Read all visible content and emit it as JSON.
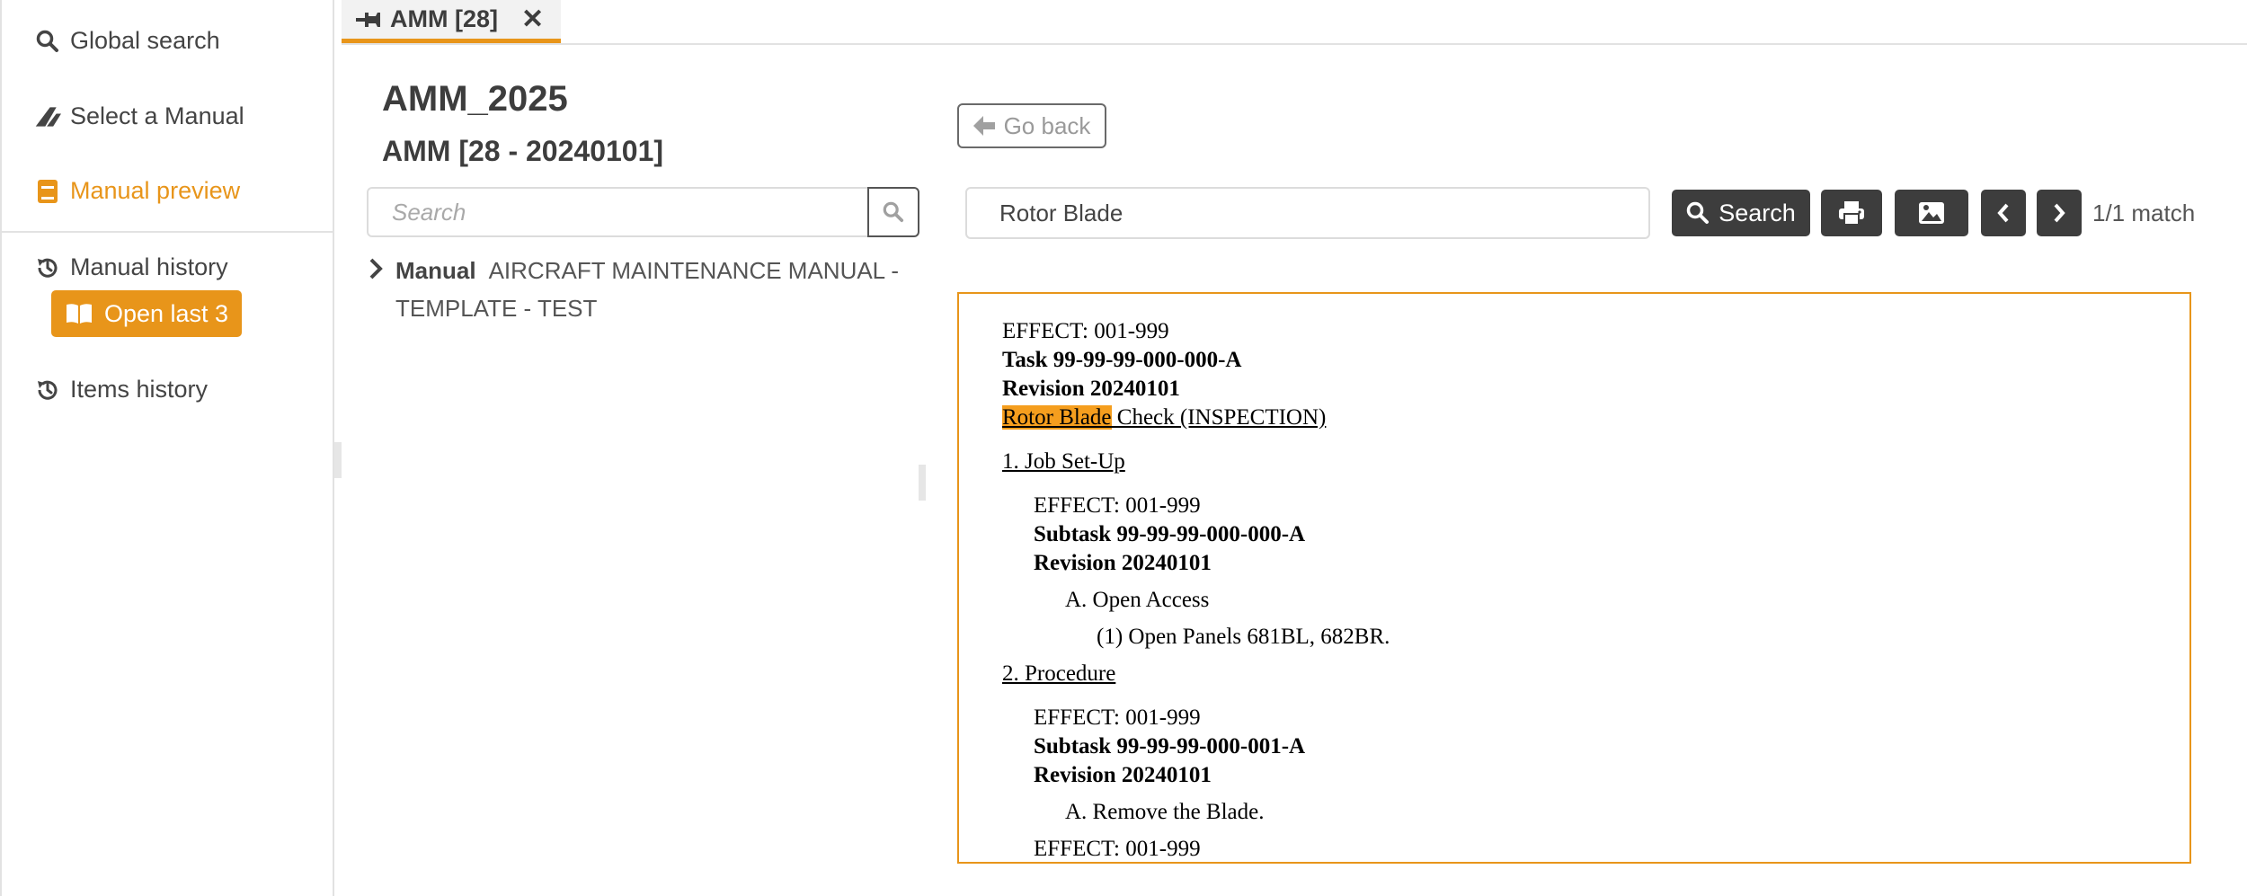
{
  "sidebar": {
    "global_search": "Global search",
    "select_manual": "Select a Manual",
    "manual_preview": "Manual preview",
    "manual_history": "Manual history",
    "open_last": "Open last 3",
    "items_history": "Items history"
  },
  "tabs": [
    {
      "label": "AMM [28]"
    }
  ],
  "tree": {
    "title": "AMM_2025",
    "subtitle": "AMM [28 - 20240101]",
    "search_placeholder": "Search",
    "node": {
      "type": "Manual",
      "label_line1": "AIRCRAFT MAINTENANCE MANUAL -",
      "label_line2": "TEMPLATE - TEST"
    }
  },
  "toolbar": {
    "go_back": "Go back",
    "search_value": "Rotor Blade",
    "search_button": "Search",
    "match_count": "1/1 match"
  },
  "document": {
    "effect1": "EFFECT: 001-999",
    "task": "Task 99-99-99-000-000-A",
    "revision1": "Revision 20240101",
    "title_highlight": "Rotor Blade",
    "title_rest": " Check (INSPECTION)",
    "section1": "1. Job Set-Up",
    "effect2": "EFFECT: 001-999",
    "subtask1": "Subtask 99-99-99-000-000-A",
    "revision2": "Revision 20240101",
    "step_a1": "A. Open Access",
    "step_1": "(1) Open Panels 681BL, 682BR.",
    "section2": "2. Procedure",
    "effect3": "EFFECT: 001-999",
    "subtask2": "Subtask 99-99-99-000-001-A",
    "revision3": "Revision 20240101",
    "step_a2": "A. Remove the Blade.",
    "effect4": "EFFECT: 001-999"
  },
  "colors": {
    "accent": "#e8951a",
    "dark_button": "#3d3d3d",
    "highlight": "#f59e1e"
  }
}
